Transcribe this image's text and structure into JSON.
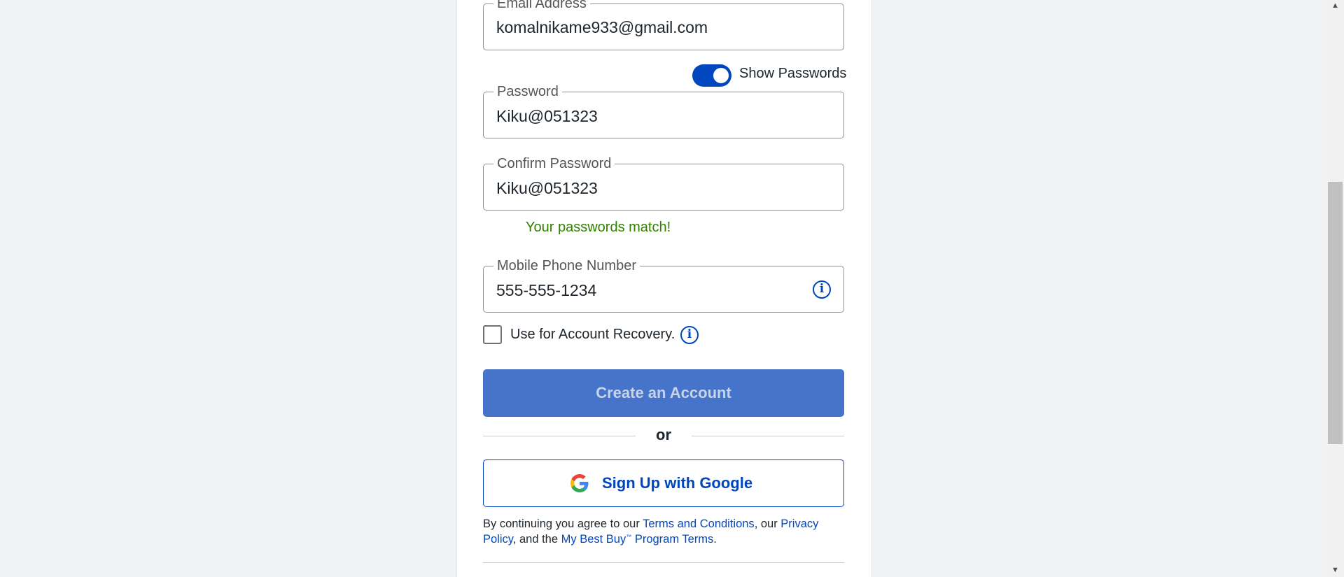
{
  "form": {
    "email": {
      "label": "Email Address",
      "value": "komalnikame933@gmail.com"
    },
    "show_passwords": {
      "label": "Show Passwords",
      "enabled": true
    },
    "password": {
      "label": "Password",
      "value": "Kiku@051323"
    },
    "confirm_password": {
      "label": "Confirm Password",
      "value": "Kiku@051323"
    },
    "match_message": "Your passwords match!",
    "phone": {
      "label": "Mobile Phone Number",
      "value": "555-555-1234",
      "info_icon": "info-icon"
    },
    "account_recovery": {
      "label": "Use for Account Recovery.",
      "checked": false,
      "info_icon": "info-icon"
    },
    "create_button": "Create an Account",
    "or_text": "or",
    "google_button": {
      "label": "Sign Up with Google",
      "icon": "google-logo-icon"
    },
    "terms": {
      "prefix": "By continuing you agree to our ",
      "terms_link": "Terms and Conditions",
      "middle": ", our ",
      "privacy_link": "Privacy Policy",
      "and_the": ", and the ",
      "program_link_main": "My Best Buy",
      "program_link_tm": "™",
      "program_link_rest": " Program Terms",
      "suffix": "."
    }
  },
  "colors": {
    "accent": "#0046be",
    "success": "#318000",
    "create_button_bg": "#4674ca",
    "page_bg": "#f0f2f4"
  }
}
